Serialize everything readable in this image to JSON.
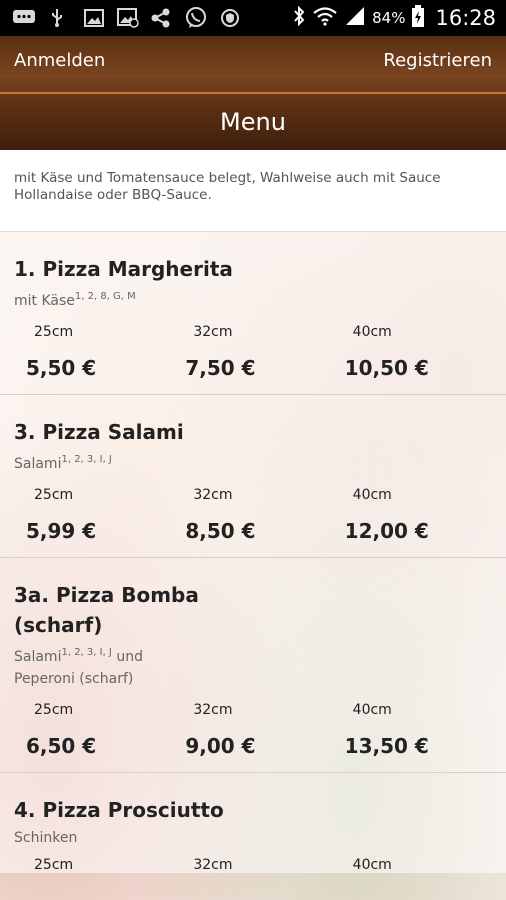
{
  "status_bar": {
    "battery_percent": "84%",
    "time": "16:28",
    "icons": [
      "chat-icon",
      "usb-icon",
      "image-icon",
      "image-off-icon",
      "share-icon",
      "viber-icon",
      "shield-icon",
      "bluetooth-icon",
      "wifi-icon",
      "signal-icon",
      "battery-icon"
    ]
  },
  "header": {
    "login_label": "Anmelden",
    "register_label": "Registrieren",
    "title": "Menu"
  },
  "intro_text": "mit Käse und Tomatensauce belegt, Wahlweise auch mit Sauce Hollandaise oder BBQ-Sauce.",
  "menu_items": [
    {
      "name": "1. Pizza Margherita",
      "desc": "mit Käse",
      "desc_sup": "1, 2, 8, G, M",
      "desc_tail": "",
      "sizes": [
        "25cm",
        "32cm",
        "40cm"
      ],
      "prices": [
        "5,50 €",
        "7,50 €",
        "10,50 €"
      ]
    },
    {
      "name": "3. Pizza Salami",
      "desc": "Salami",
      "desc_sup": "1, 2, 3, I, J",
      "desc_tail": "",
      "sizes": [
        "25cm",
        "32cm",
        "40cm"
      ],
      "prices": [
        "5,99 €",
        "8,50 €",
        "12,00 €"
      ]
    },
    {
      "name": "3a. Pizza Bomba (scharf)",
      "desc": "Salami",
      "desc_sup": "1, 2, 3, I, J",
      "desc_tail": " und Peperoni (scharf)",
      "sizes": [
        "25cm",
        "32cm",
        "40cm"
      ],
      "prices": [
        "6,50 €",
        "9,00 €",
        "13,50 €"
      ]
    },
    {
      "name": "4. Pizza Prosciutto",
      "desc": "Schinken",
      "desc_sup": "",
      "desc_tail": "",
      "sizes": [
        "25cm",
        "32cm",
        "40cm"
      ],
      "prices": []
    }
  ]
}
